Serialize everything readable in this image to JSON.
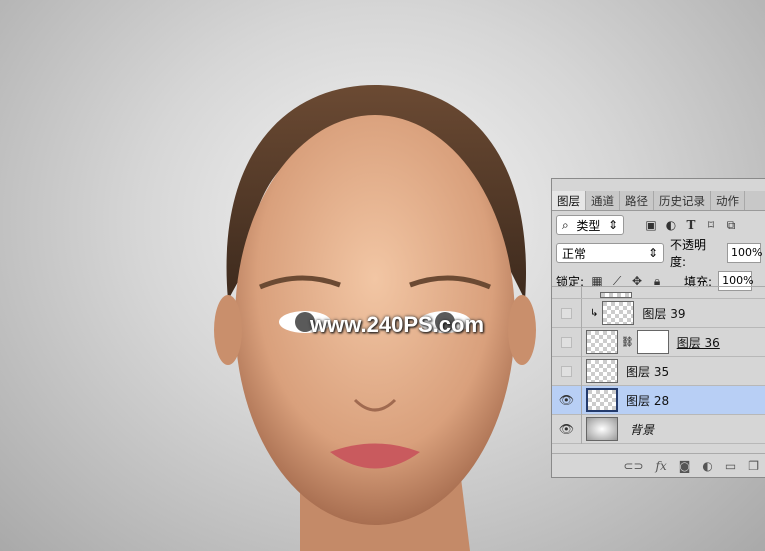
{
  "watermark": "www.240PS.com",
  "panel": {
    "tabs": [
      "图层",
      "通道",
      "路径",
      "历史记录",
      "动作"
    ],
    "filter": {
      "label": "类型",
      "icons": [
        "image-filter-icon",
        "adjustment-filter-icon",
        "type-filter-icon",
        "shape-filter-icon",
        "smart-object-filter-icon"
      ]
    },
    "blend_mode": "正常",
    "opacity_label": "不透明度:",
    "opacity": "100%",
    "lock_label": "锁定:",
    "fill_label": "填充:",
    "fill": "100%",
    "layers": [
      {
        "name": "",
        "visible": false
      },
      {
        "name": "图层 39",
        "visible": false,
        "clipped": true
      },
      {
        "name": "图层 36",
        "visible": false,
        "mask": true
      },
      {
        "name": "图层 35",
        "visible": false
      },
      {
        "name": "图层 28",
        "visible": true,
        "selected": true
      },
      {
        "name": "背景",
        "visible": true
      }
    ]
  },
  "colors": {
    "selected": "#b8cff5",
    "panel": "#d6d6d6"
  }
}
